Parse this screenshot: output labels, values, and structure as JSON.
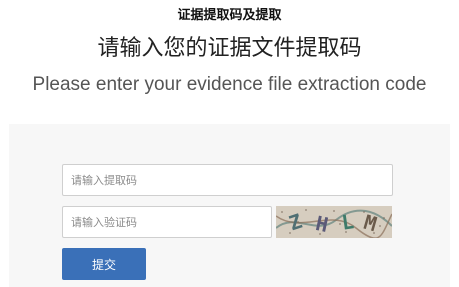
{
  "page": {
    "top_title": "证据提取码及提取",
    "heading_zh": "请输入您的证据文件提取码",
    "heading_en": "Please enter your evidence file extraction code"
  },
  "form": {
    "code_placeholder": "请输入提取码",
    "captcha_placeholder": "请输入验证码",
    "submit_label": "提交"
  },
  "captcha": {
    "text": "ZHLM"
  },
  "colors": {
    "primary_button": "#3a70b8",
    "panel_background": "#f7f7f7"
  }
}
